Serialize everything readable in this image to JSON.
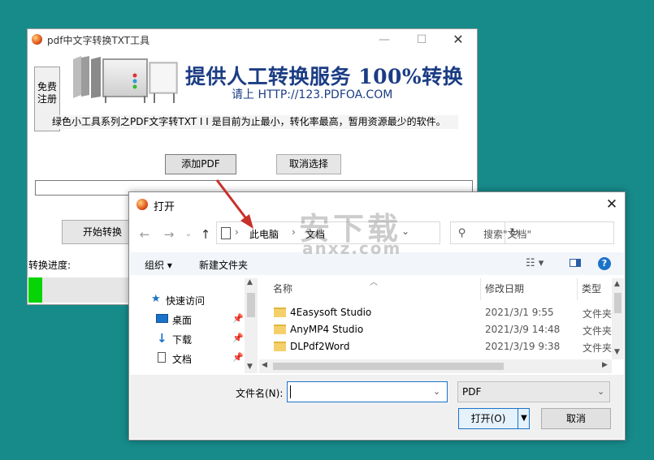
{
  "main_window": {
    "title": "pdf中文字转换TXT工具",
    "register_button": "免费注册",
    "banner_headline": "提供人工转换服务 100%转换",
    "banner_url": "请上  HTTP://123.PDFOA.COM",
    "description": "绿色小工具系列之PDF文字转TXT I I 是目前为止最小，转化率最高，暂用资源最少的软件。",
    "add_pdf_button": "添加PDF",
    "cancel_select_button": "取消选择",
    "start_button": "开始转换",
    "progress_label": "转换进度:",
    "progress_fraction": 0.03,
    "progress_color": "#06d406"
  },
  "dialog": {
    "title": "打开",
    "address": {
      "seg1": "此电脑",
      "seg2": "文档"
    },
    "search_placeholder": "搜索\"文档\"",
    "toolbar": {
      "organize": "组织 ▾",
      "new_folder": "新建文件夹"
    },
    "nav": [
      {
        "label": "快速访问",
        "icon": "star-icon"
      },
      {
        "label": "桌面",
        "icon": "desktop-icon"
      },
      {
        "label": "下载",
        "icon": "download-icon"
      },
      {
        "label": "文档",
        "icon": "document-icon"
      }
    ],
    "columns": {
      "name": "名称",
      "date": "修改日期",
      "type": "类型"
    },
    "files": [
      {
        "name": "4Easysoft Studio",
        "date": "2021/3/1 9:55",
        "type": "文件夹"
      },
      {
        "name": "AnyMP4 Studio",
        "date": "2021/3/9 14:48",
        "type": "文件夹"
      },
      {
        "name": "DLPdf2Word",
        "date": "2021/3/19 9:38",
        "type": "文件夹"
      }
    ],
    "filename_label": "文件名(N):",
    "filename_value": "",
    "filetype_value": "PDF",
    "open_button": "打开(O)",
    "cancel_button": "取消"
  },
  "watermark": {
    "cn": "安下载",
    "en": "anxz.com"
  },
  "colors": {
    "desktop": "#178a8a",
    "accent": "#1a73c8",
    "banner_text": "#1b3d84",
    "arrow": "#c8302a"
  }
}
